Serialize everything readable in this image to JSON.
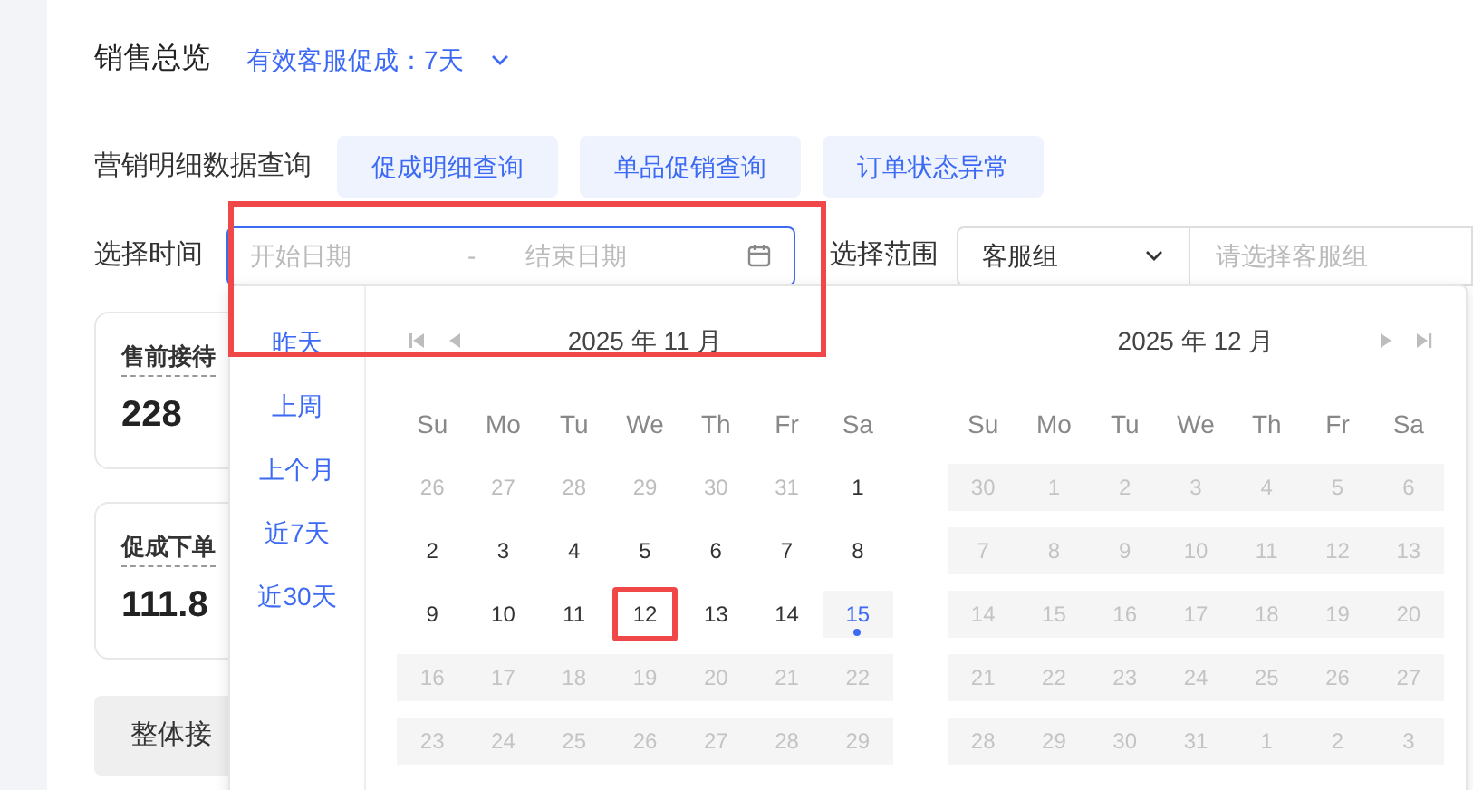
{
  "header": {
    "title": "销售总览",
    "filter": "有效客服促成：7天"
  },
  "query": {
    "label": "营销明细数据查询",
    "buttons": [
      "促成明细查询",
      "单品促销查询",
      "订单状态异常"
    ]
  },
  "time": {
    "label": "选择时间",
    "start_placeholder": "开始日期",
    "separator": "-",
    "end_placeholder": "结束日期",
    "highlighted": true
  },
  "scope": {
    "label": "选择范围",
    "select": "客服组",
    "placeholder": "请选择客服组"
  },
  "cards": [
    {
      "label": "售前接待",
      "value": "228"
    },
    {
      "label": "促成下单",
      "value": "111.8"
    }
  ],
  "tab_button": "整体接",
  "picker": {
    "presets": [
      "昨天",
      "上周",
      "上个月",
      "近7天",
      "近30天"
    ],
    "months": [
      {
        "title": "2025 年 11 月",
        "kind": "back",
        "weekdays": [
          "Su",
          "Mo",
          "Tu",
          "We",
          "Th",
          "Fr",
          "Sa"
        ],
        "weeks": [
          [
            {
              "text": "26",
              "kind": "adjacent"
            },
            {
              "text": "27",
              "kind": "adjacent"
            },
            {
              "text": "28",
              "kind": "adjacent"
            },
            {
              "text": "29",
              "kind": "adjacent"
            },
            {
              "text": "30",
              "kind": "adjacent"
            },
            {
              "text": "31",
              "kind": "adjacent"
            },
            {
              "text": "1",
              "kind": "available"
            }
          ],
          [
            {
              "text": "2",
              "kind": "available"
            },
            {
              "text": "3",
              "kind": "available"
            },
            {
              "text": "4",
              "kind": "available"
            },
            {
              "text": "5",
              "kind": "available"
            },
            {
              "text": "6",
              "kind": "available"
            },
            {
              "text": "7",
              "kind": "available"
            },
            {
              "text": "8",
              "kind": "available"
            }
          ],
          [
            {
              "text": "9",
              "kind": "available"
            },
            {
              "text": "10",
              "kind": "available"
            },
            {
              "text": "11",
              "kind": "available"
            },
            {
              "text": "12",
              "kind": "available",
              "marked": true
            },
            {
              "text": "13",
              "kind": "available"
            },
            {
              "text": "14",
              "kind": "available"
            },
            {
              "text": "15",
              "kind": "today"
            }
          ],
          [
            {
              "text": "16",
              "kind": "disabled"
            },
            {
              "text": "17",
              "kind": "disabled"
            },
            {
              "text": "18",
              "kind": "disabled"
            },
            {
              "text": "19",
              "kind": "disabled"
            },
            {
              "text": "20",
              "kind": "disabled"
            },
            {
              "text": "21",
              "kind": "disabled"
            },
            {
              "text": "22",
              "kind": "disabled"
            }
          ],
          [
            {
              "text": "23",
              "kind": "disabled"
            },
            {
              "text": "24",
              "kind": "disabled"
            },
            {
              "text": "25",
              "kind": "disabled"
            },
            {
              "text": "26",
              "kind": "disabled"
            },
            {
              "text": "27",
              "kind": "disabled"
            },
            {
              "text": "28",
              "kind": "disabled"
            },
            {
              "text": "29",
              "kind": "disabled"
            }
          ]
        ]
      },
      {
        "title": "2025 年 12 月",
        "kind": "forward",
        "weekdays": [
          "Su",
          "Mo",
          "Tu",
          "We",
          "Th",
          "Fr",
          "Sa"
        ],
        "weeks": [
          [
            {
              "text": "30",
              "kind": "disabled"
            },
            {
              "text": "1",
              "kind": "disabled"
            },
            {
              "text": "2",
              "kind": "disabled"
            },
            {
              "text": "3",
              "kind": "disabled"
            },
            {
              "text": "4",
              "kind": "disabled"
            },
            {
              "text": "5",
              "kind": "disabled"
            },
            {
              "text": "6",
              "kind": "disabled"
            }
          ],
          [
            {
              "text": "7",
              "kind": "disabled"
            },
            {
              "text": "8",
              "kind": "disabled"
            },
            {
              "text": "9",
              "kind": "disabled"
            },
            {
              "text": "10",
              "kind": "disabled"
            },
            {
              "text": "11",
              "kind": "disabled"
            },
            {
              "text": "12",
              "kind": "disabled"
            },
            {
              "text": "13",
              "kind": "disabled"
            }
          ],
          [
            {
              "text": "14",
              "kind": "disabled"
            },
            {
              "text": "15",
              "kind": "disabled"
            },
            {
              "text": "16",
              "kind": "disabled"
            },
            {
              "text": "17",
              "kind": "disabled"
            },
            {
              "text": "18",
              "kind": "disabled"
            },
            {
              "text": "19",
              "kind": "disabled"
            },
            {
              "text": "20",
              "kind": "disabled"
            }
          ],
          [
            {
              "text": "21",
              "kind": "disabled"
            },
            {
              "text": "22",
              "kind": "disabled"
            },
            {
              "text": "23",
              "kind": "disabled"
            },
            {
              "text": "24",
              "kind": "disabled"
            },
            {
              "text": "25",
              "kind": "disabled"
            },
            {
              "text": "26",
              "kind": "disabled"
            },
            {
              "text": "27",
              "kind": "disabled"
            }
          ],
          [
            {
              "text": "28",
              "kind": "disabled"
            },
            {
              "text": "29",
              "kind": "disabled"
            },
            {
              "text": "30",
              "kind": "disabled"
            },
            {
              "text": "31",
              "kind": "disabled"
            },
            {
              "text": "1",
              "kind": "disabled"
            },
            {
              "text": "2",
              "kind": "disabled"
            },
            {
              "text": "3",
              "kind": "disabled"
            }
          ]
        ]
      }
    ]
  }
}
